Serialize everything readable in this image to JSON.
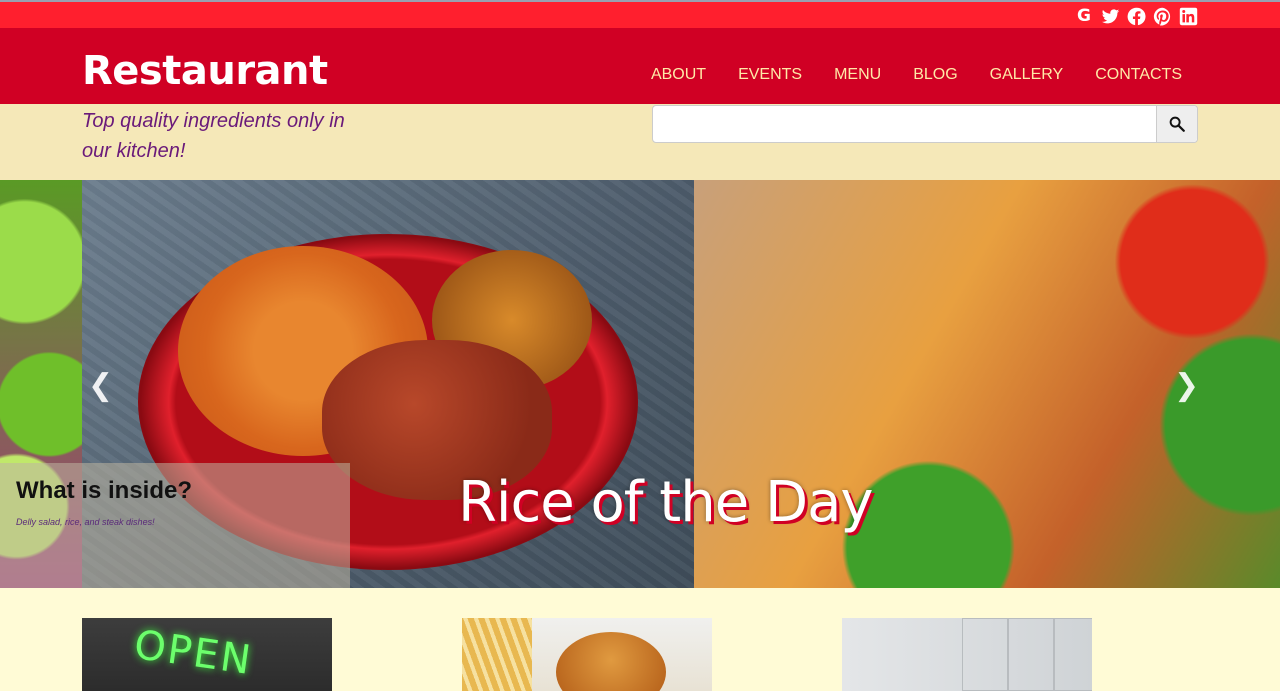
{
  "social": {
    "google": "G",
    "twitter": "twitter-icon",
    "facebook": "facebook-icon",
    "pinterest": "pinterest-icon",
    "linkedin": "linkedin-icon"
  },
  "header": {
    "brand": "Restaurant",
    "nav": [
      "ABOUT",
      "EVENTS",
      "MENU",
      "BLOG",
      "GALLERY",
      "CONTACTS"
    ]
  },
  "tagline": "Top quality ingredients only in our kitchen!",
  "search": {
    "value": "",
    "placeholder": ""
  },
  "slider": {
    "caption_title": "What is inside?",
    "caption_sub": "Delly salad, rice, and steak dishes!",
    "slide_title": "Rice of the Day"
  },
  "thumbs": {
    "neon_text": "OPEN"
  },
  "colors": {
    "topbar": "#ff1f2e",
    "header": "#d00024",
    "nav_text": "#ffe9a8",
    "tag_band": "#f5e8b8",
    "tagline": "#6a1a7a",
    "page_bg": "#fffbd6"
  }
}
